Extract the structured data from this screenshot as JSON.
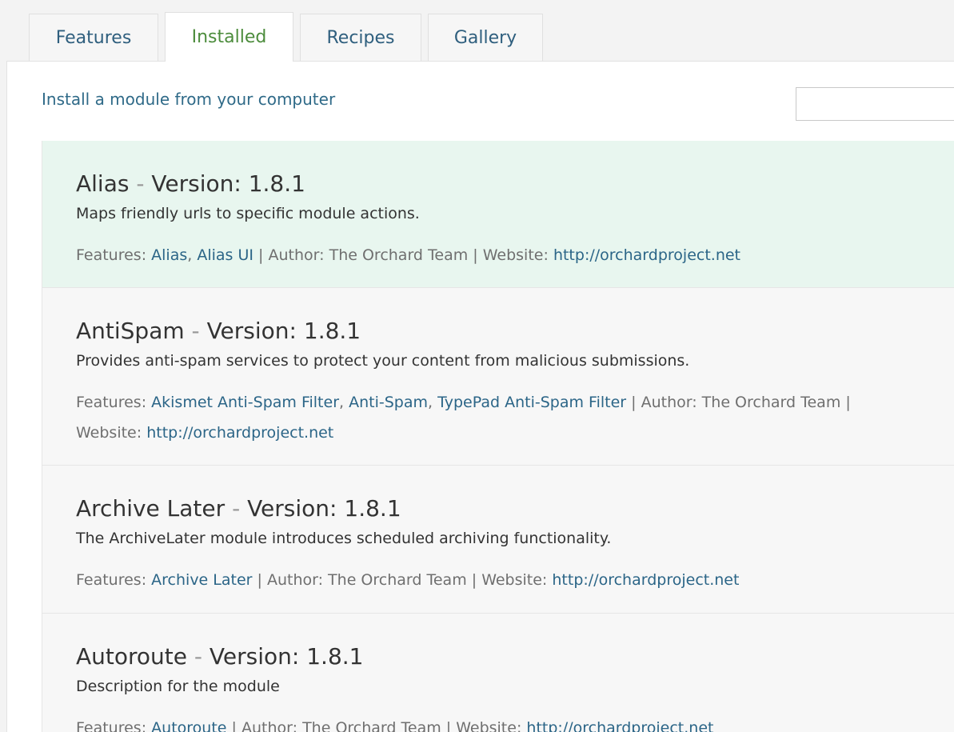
{
  "tabs": [
    {
      "label": "Features",
      "active": false
    },
    {
      "label": "Installed",
      "active": true
    },
    {
      "label": "Recipes",
      "active": false
    },
    {
      "label": "Gallery",
      "active": false
    }
  ],
  "install_link": "Install a module from your computer",
  "search": {
    "value": "",
    "placeholder": ""
  },
  "labels": {
    "version": "Version:",
    "features": "Features:",
    "author": "Author:",
    "website": "Website:"
  },
  "modules": [
    {
      "name": "Alias",
      "version": "1.8.1",
      "description": "Maps friendly urls to specific module actions.",
      "features": [
        "Alias",
        "Alias UI"
      ],
      "author": "The Orchard Team",
      "website": "http://orchardproject.net",
      "highlighted": true
    },
    {
      "name": "AntiSpam",
      "version": "1.8.1",
      "description": "Provides anti-spam services to protect your content from malicious submissions.",
      "features": [
        "Akismet Anti-Spam Filter",
        "Anti-Spam",
        "TypePad Anti-Spam Filter"
      ],
      "author": "The Orchard Team",
      "website": "http://orchardproject.net",
      "highlighted": false
    },
    {
      "name": "Archive Later",
      "version": "1.8.1",
      "description": "The ArchiveLater module introduces scheduled archiving functionality.",
      "features": [
        "Archive Later"
      ],
      "author": "The Orchard Team",
      "website": "http://orchardproject.net",
      "highlighted": false
    },
    {
      "name": "Autoroute",
      "version": "1.8.1",
      "description": "Description for the module",
      "features": [
        "Autoroute"
      ],
      "author": "The Orchard Team",
      "website": "http://orchardproject.net",
      "highlighted": false
    }
  ],
  "colors": {
    "accent_green": "#4c8c3c",
    "link_blue": "#2b6587",
    "highlight_bg": "#e8f6ef",
    "row_bg": "#f7f7f7"
  }
}
